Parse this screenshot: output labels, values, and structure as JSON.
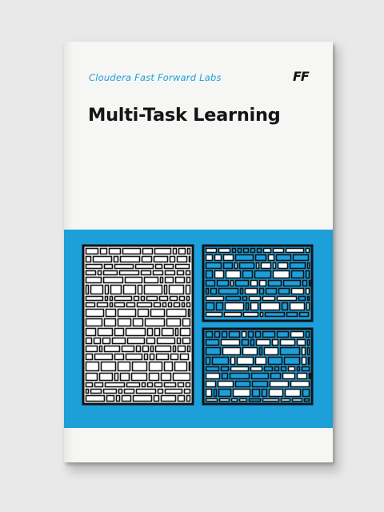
{
  "book": {
    "publisher": "Cloudera Fast Forward Labs",
    "logo_text": "FF",
    "title": "Multi-Task Learning"
  },
  "colors": {
    "accent": "#1d9fda",
    "ink": "#111111",
    "paper": "#f6f6f4"
  }
}
